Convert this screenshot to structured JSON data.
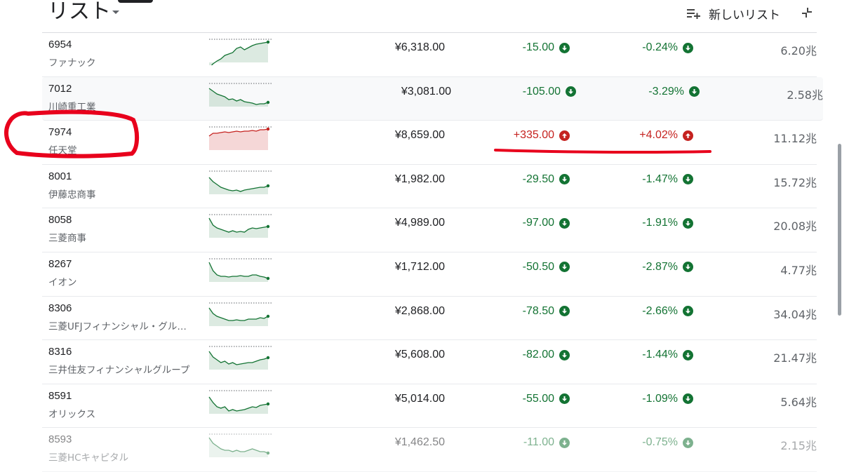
{
  "header": {
    "title": "リスト",
    "new_list_label": "新しいリスト",
    "icons": {
      "title_dropdown": "caret-down-icon",
      "new_list": "playlist-add-icon",
      "collapse": "collapse-icon"
    }
  },
  "colors": {
    "gain": "#c5221f",
    "loss": "#137333",
    "annotation": "#e8001c"
  },
  "stocks": [
    {
      "symbol": "6954",
      "name": "ファナック",
      "price": "¥6,318.00",
      "change": "-15.00",
      "percent": "-0.24%",
      "market_cap": "6.20兆",
      "direction": "down"
    },
    {
      "symbol": "7012",
      "name": "川崎重工業",
      "price": "¥3,081.00",
      "change": "-105.00",
      "percent": "-3.29%",
      "market_cap": "2.58兆",
      "direction": "down"
    },
    {
      "symbol": "7974",
      "name": "任天堂",
      "price": "¥8,659.00",
      "change": "+335.00",
      "percent": "+4.02%",
      "market_cap": "11.12兆",
      "direction": "up"
    },
    {
      "symbol": "8001",
      "name": "伊藤忠商事",
      "price": "¥1,982.00",
      "change": "-29.50",
      "percent": "-1.47%",
      "market_cap": "15.72兆",
      "direction": "down"
    },
    {
      "symbol": "8058",
      "name": "三菱商事",
      "price": "¥4,989.00",
      "change": "-97.00",
      "percent": "-1.91%",
      "market_cap": "20.08兆",
      "direction": "down"
    },
    {
      "symbol": "8267",
      "name": "イオン",
      "price": "¥1,712.00",
      "change": "-50.50",
      "percent": "-2.87%",
      "market_cap": "4.77兆",
      "direction": "down"
    },
    {
      "symbol": "8306",
      "name": "三菱UFJフィナンシャル・グル…",
      "price": "¥2,868.00",
      "change": "-78.50",
      "percent": "-2.66%",
      "market_cap": "34.04兆",
      "direction": "down"
    },
    {
      "symbol": "8316",
      "name": "三井住友フィナンシャルグループ",
      "price": "¥5,608.00",
      "change": "-82.00",
      "percent": "-1.44%",
      "market_cap": "21.47兆",
      "direction": "down"
    },
    {
      "symbol": "8591",
      "name": "オリックス",
      "price": "¥5,014.00",
      "change": "-55.00",
      "percent": "-1.09%",
      "market_cap": "5.64兆",
      "direction": "down"
    },
    {
      "symbol": "8593",
      "name": "三菱HCキャピタル",
      "price": "¥1,462.50",
      "change": "-11.00",
      "percent": "-0.75%",
      "market_cap": "2.15兆",
      "direction": "down"
    }
  ]
}
